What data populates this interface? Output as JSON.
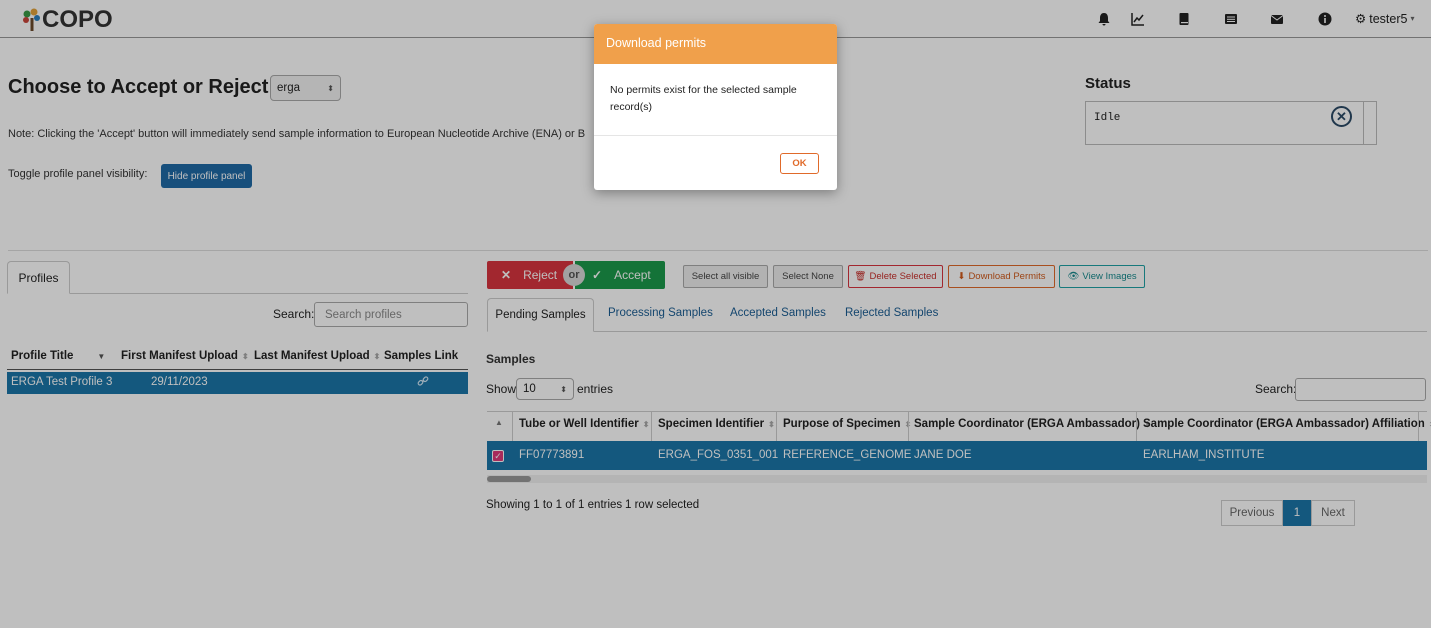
{
  "navbar": {
    "logo_text": "COPO",
    "icons": [
      "bell-icon",
      "chart-line-icon",
      "book-icon",
      "list-icon",
      "envelope-icon",
      "info-circle-icon"
    ],
    "user": "tester5"
  },
  "header": {
    "title": "Choose to Accept or Reject",
    "profile_type": "erga",
    "note": "Note: Clicking the 'Accept' button will immediately send sample information to European Nucleotide Archive (ENA) or B",
    "toggle_label": "Toggle profile panel visibility:",
    "toggle_button": "Hide profile panel"
  },
  "status": {
    "title": "Status",
    "value": "Idle"
  },
  "profiles": {
    "tab_label": "Profiles",
    "search_label": "Search:",
    "search_placeholder": "Search profiles",
    "columns": [
      "Profile Title",
      "First Manifest Upload",
      "Last Manifest Upload",
      "Samples Link"
    ],
    "rows": [
      {
        "title": "ERGA Test Profile 3",
        "first_upload": "29/11/2023",
        "last_upload": ""
      }
    ]
  },
  "actions": {
    "reject": "Reject",
    "or": "or",
    "accept": "Accept",
    "select_all": "Select all visible",
    "select_none": "Select None",
    "delete_selected": "Delete Selected",
    "download_permits": "Download Permits",
    "view_images": "View Images"
  },
  "sample_tabs": [
    "Pending Samples",
    "Processing Samples",
    "Accepted Samples",
    "Rejected Samples"
  ],
  "samples": {
    "title": "Samples",
    "show_label": "Show",
    "entries_value": "10",
    "entries_label": "entries",
    "search_label": "Search:",
    "columns": [
      "Tube or Well Identifier",
      "Specimen Identifier",
      "Purpose of Specimen",
      "Sample Coordinator (ERGA Ambassador)",
      "Sample Coordinator (ERGA Ambassador) Affiliation"
    ],
    "rows": [
      {
        "tube": "FF07773891",
        "specimen": "ERGA_FOS_0351_001",
        "purpose": "REFERENCE_GENOME",
        "coordinator": "JANE DOE",
        "affiliation": "EARLHAM_INSTITUTE"
      }
    ],
    "info": "Showing 1 to 1 of 1 entries",
    "selected_info": "1 row selected",
    "pager": {
      "previous": "Previous",
      "current": "1",
      "next": "Next"
    }
  },
  "modal": {
    "title": "Download permits",
    "message": "No permits exist for the selected sample record(s)",
    "ok": "OK"
  },
  "colors": {
    "modal_header": "#f0a04b",
    "selected_row": "#1b76a8",
    "reject": "#d9353f",
    "accept": "#1b9a4b"
  }
}
